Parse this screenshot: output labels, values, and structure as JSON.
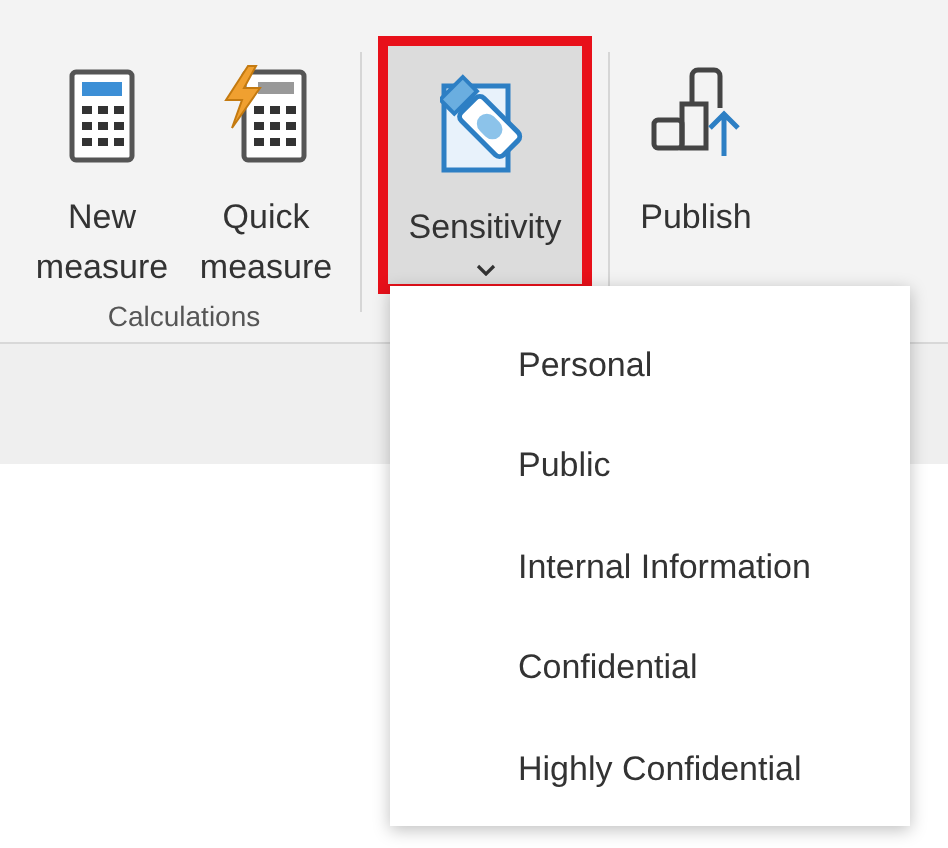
{
  "ribbon": {
    "groups": [
      {
        "label": "Calculations",
        "buttons": [
          {
            "kind": "calculator",
            "label": "New measure",
            "selected": false
          },
          {
            "kind": "quick",
            "label": "Quick measure",
            "selected": false
          }
        ]
      },
      {
        "buttons": [
          {
            "kind": "sensitivity",
            "label": "Sensitivity",
            "dropdown": true,
            "highlighted": true,
            "selected": true
          }
        ]
      },
      {
        "buttons": [
          {
            "kind": "publish",
            "label": "Publish",
            "selected": false
          }
        ]
      }
    ]
  },
  "menu": {
    "items": [
      {
        "label": "Personal"
      },
      {
        "label": "Public"
      },
      {
        "label": "Internal Information"
      },
      {
        "label": "Confidential"
      },
      {
        "label": "Highly Confidential"
      }
    ]
  }
}
